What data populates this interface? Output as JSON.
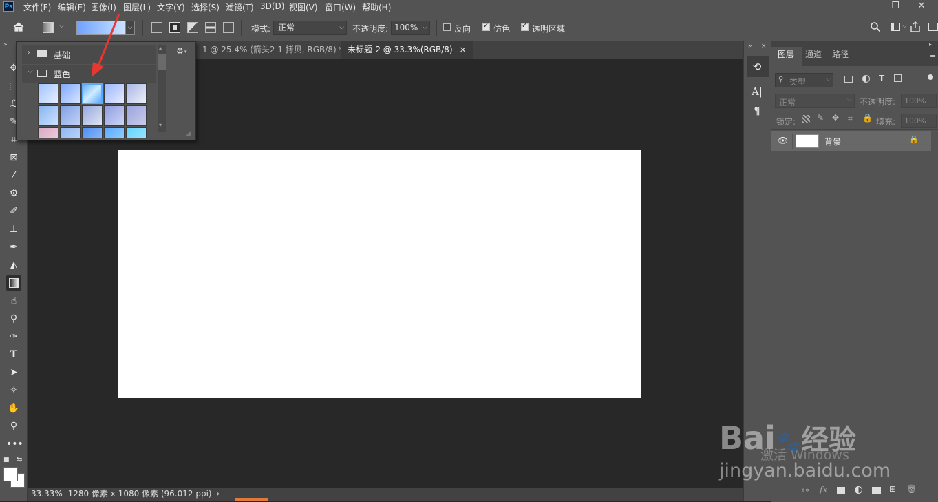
{
  "app": {
    "logo": "Ps"
  },
  "menu": [
    "文件(F)",
    "编辑(E)",
    "图像(I)",
    "图层(L)",
    "文字(Y)",
    "选择(S)",
    "滤镜(T)",
    "3D(D)",
    "视图(V)",
    "窗口(W)",
    "帮助(H)"
  ],
  "window_controls": [
    "—",
    "❐",
    "✕"
  ],
  "options": {
    "mode_label": "模式:",
    "mode_value": "正常",
    "opacity_label": "不透明度:",
    "opacity_value": "100%",
    "reverse_label": "反向",
    "dither_label": "仿色",
    "transparency_label": "透明区域",
    "reverse_checked": false,
    "dither_checked": true,
    "transparency_checked": true
  },
  "gradient_picker": {
    "folders": [
      {
        "label": "基础",
        "expanded": false
      },
      {
        "label": "蓝色",
        "expanded": true
      }
    ],
    "selected_index": 2
  },
  "tabs": [
    {
      "label": "1 @ 25.4% (箭头2 1 拷贝, RGB/8) *",
      "close": "×",
      "active": false
    },
    {
      "label": "未标题-2 @ 33.3%(RGB/8)",
      "close": "×",
      "active": true
    }
  ],
  "status": {
    "zoom": "33.33%",
    "info": "1280 像素 x 1080 像素 (96.012 ppi)",
    "arrow": "›"
  },
  "layers_panel": {
    "tabs": [
      "图层",
      "通道",
      "路径"
    ],
    "search_placeholder": "类型",
    "blend_mode": "正常",
    "opacity_label": "不透明度:",
    "opacity_value": "100%",
    "lock_label": "锁定:",
    "fill_label": "填充:",
    "fill_value": "100%",
    "layers": [
      {
        "name": "背景",
        "visible": true,
        "locked": true
      }
    ],
    "bottom_icons": [
      "link-icon",
      "fx-icon",
      "mask-icon",
      "adjustment-icon",
      "folder-icon",
      "new-layer-icon",
      "trash-icon"
    ],
    "fx_text": "fx"
  },
  "watermark": {
    "activate": "激活 Windows",
    "brand_text": "Bai",
    "brand_suffix": "经验",
    "url": "jingyan.baidu.com"
  },
  "colors": {
    "bg_panel": "#535353",
    "bg_dark": "#282828",
    "accent": "#31a8ff",
    "arrow": "#e8372f"
  }
}
